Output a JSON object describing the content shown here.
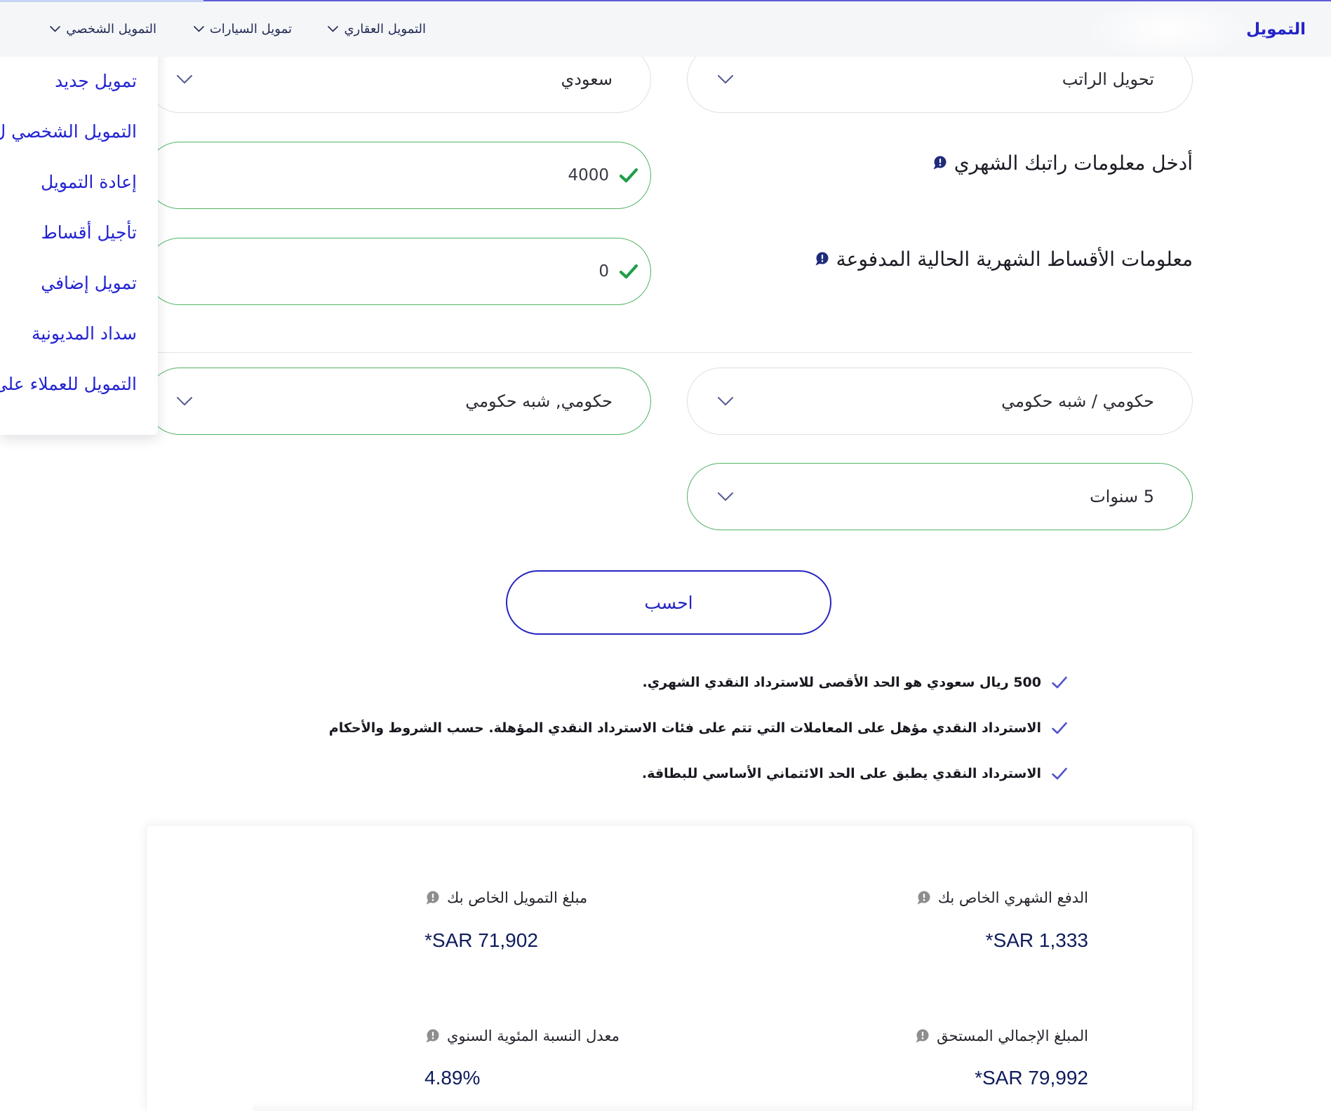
{
  "nav": {
    "brand": "التمويل",
    "menu": [
      {
        "label": "التمويل العقاري"
      },
      {
        "label": "تمويل السيارات"
      },
      {
        "label": "التمويل الشخصي"
      }
    ]
  },
  "dropdown": {
    "items": [
      {
        "label": "تمويل جديد"
      },
      {
        "label": "التمويل الشخصي ل"
      },
      {
        "label": "إعادة التمويل"
      },
      {
        "label": "تأجيل أقساط"
      },
      {
        "label": "تمويل إضافي"
      },
      {
        "label": "سداد المديونية"
      },
      {
        "label": "التمويل للعملاء على"
      }
    ]
  },
  "form": {
    "salary_transfer": "تحويل الراتب",
    "nationality": "سعودي",
    "monthly_salary": {
      "label": "أدخل معلومات راتبك الشهري",
      "value": "4000"
    },
    "current_installments": {
      "label": "معلومات الأقساط الشهرية الحالية المدفوعة",
      "value": "0"
    },
    "sector": "حكومي / شبه حكومي",
    "employer_category": "حكومي, شبه حكومي",
    "tenure": "5 سنوات",
    "calculate_label": "احسب"
  },
  "notes": [
    {
      "text": "500 ريال سعودي هو الحد الأقصى للاسترداد النقدي الشهري."
    },
    {
      "text": "الاسترداد النقدي مؤهل على المعاملات التي تتم على فئات الاسترداد النقدي المؤهلة. حسب الشروط والأحكام"
    },
    {
      "text": "الاسترداد النقدي يطبق على الحد الائتماني الأساسي للبطاقة."
    }
  ],
  "results": {
    "monthly_payment": {
      "label": "الدفع الشهري الخاص بك",
      "value": "*SAR 1,333"
    },
    "finance_amount": {
      "label": "مبلغ التمويل الخاص بك",
      "value": "*SAR 71,902"
    },
    "total_due": {
      "label": "المبلغ الإجمالي المستحق",
      "value": "*SAR 79,992"
    },
    "apr": {
      "label": "معدل النسبة المئوية السنوي",
      "value": "4.89%"
    }
  },
  "icons": {
    "nav_menu": "chevron-down-icon",
    "select": "chevron-down-icon",
    "valid_field": "check-icon",
    "note": "check-icon",
    "info": "info-bubble-icon"
  },
  "colors": {
    "accent": "#2424c6",
    "nav_text": "#222a55",
    "valid_border": "#52b264",
    "valid_check": "#1f9e47",
    "note_check": "#5252cf",
    "value_text": "#0e1c5b",
    "info_icon": "#1f2b7a",
    "info_icon_muted": "#8e8e8e"
  }
}
